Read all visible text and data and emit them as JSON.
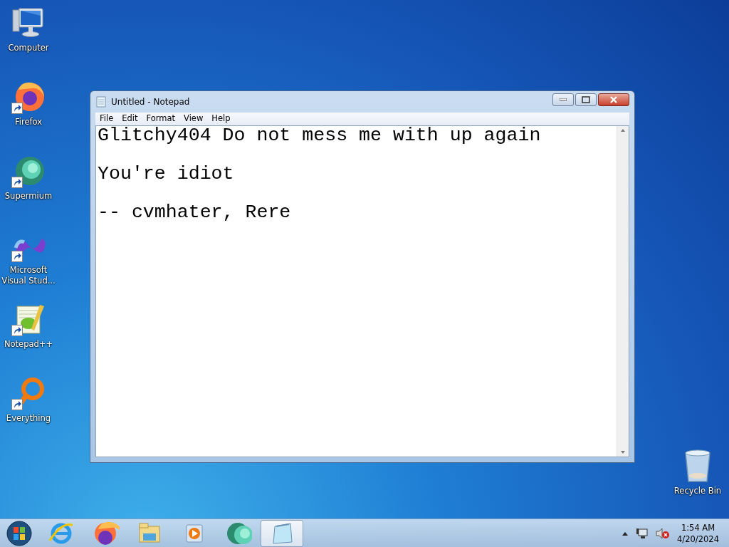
{
  "desktop_icons": [
    {
      "label": "Computer",
      "kind": "computer",
      "shortcut": false
    },
    {
      "label": "Firefox",
      "kind": "firefox",
      "shortcut": true
    },
    {
      "label": "Supermium",
      "kind": "supermium",
      "shortcut": true
    },
    {
      "label": "Microsoft Visual Stud...",
      "kind": "vstudio",
      "shortcut": true
    },
    {
      "label": "Notepad++",
      "kind": "notepadpp",
      "shortcut": true
    },
    {
      "label": "Everything",
      "kind": "everything",
      "shortcut": true
    }
  ],
  "recycle_bin": {
    "label": "Recycle Bin"
  },
  "window": {
    "title": "Untitled - Notepad",
    "menu": [
      "File",
      "Edit",
      "Format",
      "View",
      "Help"
    ],
    "paragraphs": [
      "Glitchy404 Do not mess me with up again",
      "You're idiot",
      "-- cvmhater, Rere"
    ]
  },
  "taskbar": {
    "items": [
      {
        "kind": "ie",
        "selected": false
      },
      {
        "kind": "firefox",
        "selected": false
      },
      {
        "kind": "explorer",
        "selected": false
      },
      {
        "kind": "mediaplayer",
        "selected": false
      },
      {
        "kind": "supermium",
        "selected": false
      },
      {
        "kind": "notepad",
        "selected": true
      }
    ],
    "time": "1:54 AM",
    "date": "4/20/2024"
  }
}
